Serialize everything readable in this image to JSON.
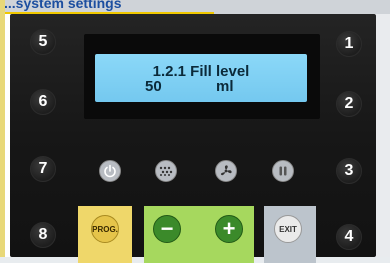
{
  "header": {
    "title": "...system settings"
  },
  "display": {
    "line1": "1.2.1 Fill level",
    "value": "50",
    "unit": "ml"
  },
  "left_keys": [
    "5",
    "6",
    "7",
    "8"
  ],
  "right_keys": [
    "1",
    "2",
    "3",
    "4"
  ],
  "function_keys": [
    {
      "icon": "power-icon"
    },
    {
      "icon": "keypad-icon"
    },
    {
      "icon": "fan-icon"
    },
    {
      "icon": "pause-icon"
    }
  ],
  "bottom_keys": {
    "prog": "PROG.",
    "minus": "−",
    "plus": "+",
    "exit": "EXIT"
  },
  "colors": {
    "lcd": "#7fd0f4",
    "prog": "#e5c44a",
    "plusminus": "#3b8a2a",
    "exit": "#eaeaea"
  }
}
